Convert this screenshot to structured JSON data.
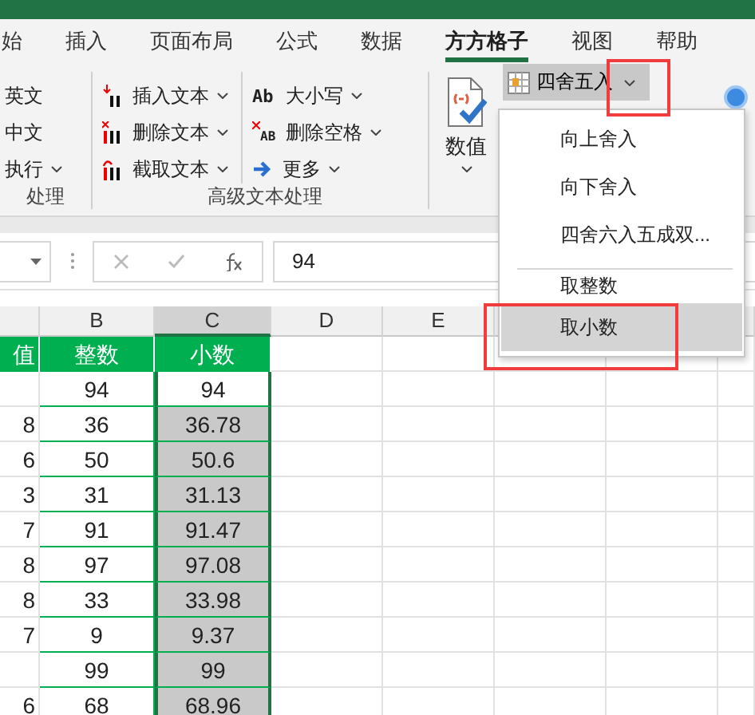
{
  "ribbon_tabs": [
    {
      "label": "始",
      "selected": false
    },
    {
      "label": "插入",
      "selected": false
    },
    {
      "label": "页面布局",
      "selected": false
    },
    {
      "label": "公式",
      "selected": false
    },
    {
      "label": "数据",
      "selected": false
    },
    {
      "label": "方方格子",
      "selected": true
    },
    {
      "label": "视图",
      "selected": false
    },
    {
      "label": "帮助",
      "selected": false
    }
  ],
  "left_group": {
    "items": [
      {
        "label": "英文",
        "dropdown": false
      },
      {
        "label": "中文",
        "dropdown": false
      },
      {
        "label": "执行",
        "dropdown": true
      }
    ],
    "caption": "处理"
  },
  "text_group": {
    "caption": "高级文本处理",
    "columns": [
      [
        {
          "kind": "insert",
          "label": "插入文本"
        },
        {
          "kind": "delete",
          "label": "删除文本"
        },
        {
          "kind": "extract",
          "label": "截取文本"
        }
      ],
      [
        {
          "kind": "case",
          "icon_text": "Ab",
          "label": "大小写"
        },
        {
          "kind": "trim",
          "icon_text": "AB",
          "label": "删除空格"
        },
        {
          "kind": "more",
          "label": "更多"
        }
      ]
    ]
  },
  "number_button": {
    "label": "数值"
  },
  "round_button": {
    "label": "四舍五入",
    "highlighted": true
  },
  "dropdown_menu": {
    "items": [
      {
        "label": "向上舍入",
        "selected": false,
        "separator_before": false
      },
      {
        "label": "向下舍入",
        "selected": false,
        "separator_before": false
      },
      {
        "label": "四舍六入五成双...",
        "selected": false,
        "separator_before": false
      },
      {
        "label": "取整数",
        "selected": false,
        "separator_before": true
      },
      {
        "label": "取小数",
        "selected": true,
        "separator_before": false
      }
    ]
  },
  "formula_bar": {
    "value": "94"
  },
  "sheet": {
    "columns": [
      {
        "label": "B",
        "selected": false
      },
      {
        "label": "C",
        "selected": true
      },
      {
        "label": "D",
        "selected": false
      },
      {
        "label": "E",
        "selected": false
      }
    ],
    "rows": [
      {
        "kind": "header",
        "a": "值",
        "b": "整数",
        "c": "小数"
      },
      {
        "kind": "data",
        "b": "94",
        "c": "94",
        "active": true
      },
      {
        "kind": "data",
        "a": "8",
        "b": "36",
        "c": "36.78",
        "active": false
      },
      {
        "kind": "data",
        "a": "6",
        "b": "50",
        "c": "50.6",
        "active": false
      },
      {
        "kind": "data",
        "a": "3",
        "b": "31",
        "c": "31.13",
        "active": false
      },
      {
        "kind": "data",
        "a": "7",
        "b": "91",
        "c": "91.47",
        "active": false
      },
      {
        "kind": "data",
        "a": "8",
        "b": "97",
        "c": "97.08",
        "active": false
      },
      {
        "kind": "data",
        "a": "8",
        "b": "33",
        "c": "33.98",
        "active": false
      },
      {
        "kind": "data",
        "a": "7",
        "b": "9",
        "c": "9.37",
        "active": false
      },
      {
        "kind": "data",
        "b": "99",
        "c": "99",
        "active": false
      },
      {
        "kind": "data",
        "a": "6",
        "b": "68",
        "c": "68.96",
        "active": false
      }
    ]
  }
}
